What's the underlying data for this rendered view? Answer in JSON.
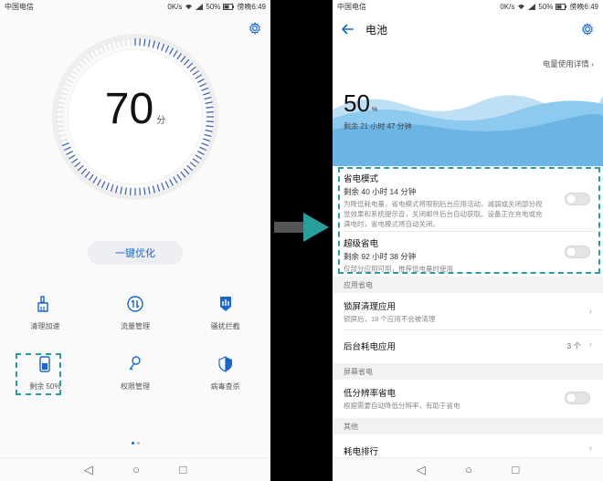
{
  "status_left": {
    "carrier": "中国电信",
    "speed": "0K/s",
    "battery": "50%",
    "time": "傍晚6:49"
  },
  "status_right": {
    "carrier": "中国电信",
    "speed": "0K/s",
    "battery": "50%",
    "time": "傍晚6:49"
  },
  "left_screen": {
    "score": "70",
    "score_unit": "分",
    "optimize_label": "一键优化",
    "grid": [
      {
        "label": "清理加速",
        "icon": "broom-icon"
      },
      {
        "label": "流量管理",
        "icon": "data-flow-icon"
      },
      {
        "label": "骚扰拦截",
        "icon": "hand-block-icon"
      },
      {
        "label": "剩余 50%",
        "icon": "battery-phone-icon"
      },
      {
        "label": "权限管理",
        "icon": "key-icon"
      },
      {
        "label": "病毒查杀",
        "icon": "shield-icon"
      }
    ]
  },
  "right_screen": {
    "title": "电池",
    "details_link": "电量使用详情",
    "battery_percent": "50",
    "percent_sign": "%",
    "remaining": "剩余 21 小时 47 分钟",
    "power_saving": {
      "title": "省电模式",
      "remaining": "剩余 40 小时 14 分钟",
      "description": "为降低耗电量，省电模式将限制后台应用活动，减弱或关闭部分视觉效果和系统提示音，关闭邮件后台自动获取。设备正在充电或充满电时，省电模式将自动关闭。"
    },
    "ultra_saving": {
      "title": "超级省电",
      "remaining": "剩余 92 小时 38 分钟",
      "description": "仅部分应用可用，推荐低电量时使用"
    },
    "section_app": "应用省电",
    "lock_clean": {
      "title": "锁屏清理应用",
      "description": "锁屏后，18 个应用不会被清理"
    },
    "background_apps": {
      "title": "后台耗电应用",
      "count": "3 个"
    },
    "section_screen": "屏幕省电",
    "low_res": {
      "title": "低分辨率省电",
      "description": "根据需要自动降低分辨率，有助于省电"
    },
    "section_other": "其他",
    "ranking": {
      "title": "耗电排行"
    }
  },
  "colors": {
    "accent": "#1a66cc",
    "highlight": "#2a9d9d",
    "wave": "#6cb4e4"
  }
}
